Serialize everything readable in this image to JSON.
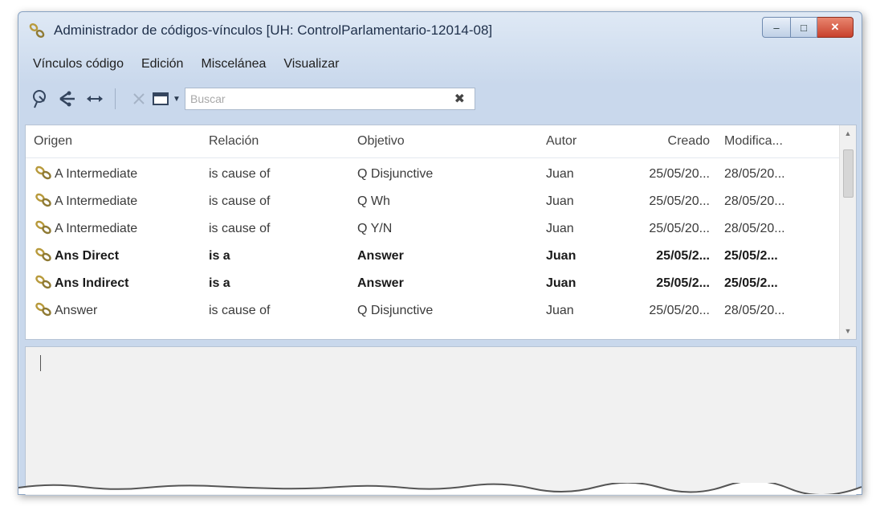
{
  "window": {
    "title": "Administrador de códigos-vínculos [UH: ControlParlamentario-12014-08]",
    "controls": {
      "minimize": "–",
      "maximize": "□",
      "close": "✕"
    }
  },
  "menu": {
    "items": [
      {
        "label": "Vínculos código"
      },
      {
        "label": "Edición"
      },
      {
        "label": "Miscelánea"
      },
      {
        "label": "Visualizar"
      }
    ]
  },
  "toolbar": {
    "icons": [
      "new-link-icon",
      "tree-link-icon",
      "double-arrow-icon",
      "delete-icon",
      "view-window-icon"
    ],
    "search": {
      "placeholder": "Buscar",
      "value": "",
      "clear_symbol": "✖"
    }
  },
  "table": {
    "columns": {
      "origen": "Origen",
      "relacion": "Relación",
      "objetivo": "Objetivo",
      "autor": "Autor",
      "creado": "Creado",
      "modificado": "Modifica..."
    },
    "rows": [
      {
        "origen": "A Intermediate",
        "relacion": "is cause of",
        "objetivo": "Q Disjunctive",
        "autor": "Juan",
        "creado": "25/05/20...",
        "modificado": "28/05/20...",
        "bold": false
      },
      {
        "origen": "A Intermediate",
        "relacion": "is cause of",
        "objetivo": "Q Wh",
        "autor": "Juan",
        "creado": "25/05/20...",
        "modificado": "28/05/20...",
        "bold": false
      },
      {
        "origen": "A Intermediate",
        "relacion": "is cause of",
        "objetivo": "Q Y/N",
        "autor": "Juan",
        "creado": "25/05/20...",
        "modificado": "28/05/20...",
        "bold": false
      },
      {
        "origen": "Ans Direct",
        "relacion": "is a",
        "objetivo": "Answer",
        "autor": "Juan",
        "creado": "25/05/2...",
        "modificado": "25/05/2...",
        "bold": true
      },
      {
        "origen": "Ans Indirect",
        "relacion": "is a",
        "objetivo": "Answer",
        "autor": "Juan",
        "creado": "25/05/2...",
        "modificado": "25/05/2...",
        "bold": true
      },
      {
        "origen": "Answer",
        "relacion": "is cause of",
        "objetivo": "Q Disjunctive",
        "autor": "Juan",
        "creado": "25/05/20...",
        "modificado": "28/05/20...",
        "bold": false
      }
    ]
  },
  "colors": {
    "chrome": "#c9d8ec",
    "link_icon": "#b89a3c",
    "close_button": "#c8412d"
  }
}
